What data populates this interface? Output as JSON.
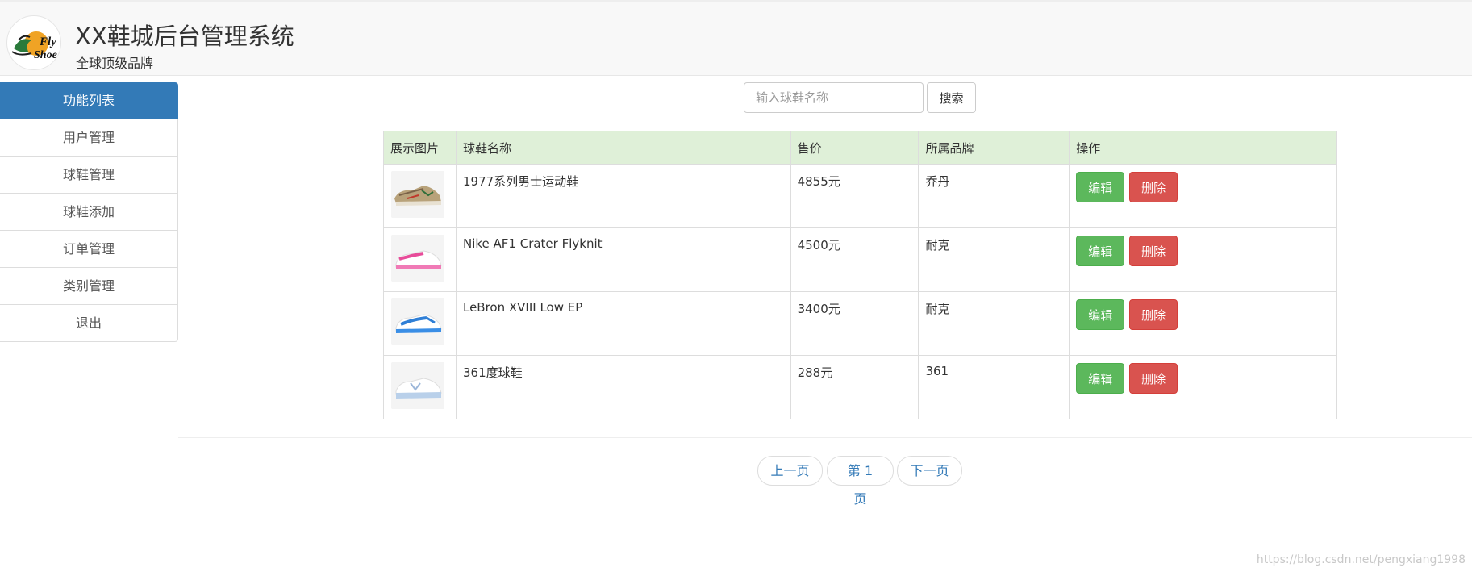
{
  "header": {
    "title": "XX鞋城后台管理系统",
    "subtitle": "全球顶级品牌",
    "logo_text": "Fly Shoe"
  },
  "sidebar": {
    "items": [
      {
        "label": "功能列表",
        "active": true
      },
      {
        "label": "用户管理"
      },
      {
        "label": "球鞋管理"
      },
      {
        "label": "球鞋添加"
      },
      {
        "label": "订单管理"
      },
      {
        "label": "类别管理"
      },
      {
        "label": "退出"
      }
    ]
  },
  "search": {
    "placeholder": "输入球鞋名称",
    "button_label": "搜索"
  },
  "table": {
    "headers": [
      "展示图片",
      "球鞋名称",
      "售价",
      "所属品牌",
      "操作"
    ],
    "rows": [
      {
        "name": "1977系列男士运动鞋",
        "price": "4855元",
        "brand": "乔丹",
        "thumb": "sneaker-tan-thumb"
      },
      {
        "name": "Nike AF1 Crater Flyknit",
        "price": "4500元",
        "brand": "耐克",
        "thumb": "sneaker-pink-thumb"
      },
      {
        "name": "LeBron XVIII Low EP",
        "price": "3400元",
        "brand": "耐克",
        "thumb": "sneaker-blue-thumb"
      },
      {
        "name": "361度球鞋",
        "price": "288元",
        "brand": "361",
        "thumb": "sneaker-white-thumb"
      }
    ],
    "edit_label": "编辑",
    "delete_label": "删除"
  },
  "pagination": {
    "prev": "上一页",
    "current": "第 1 页",
    "next": "下一页"
  },
  "watermark": "https://blog.csdn.net/pengxiang1998",
  "colors": {
    "primary": "#337ab7",
    "success": "#5cb85c",
    "danger": "#d9534f",
    "table_header": "#dff0d8"
  }
}
